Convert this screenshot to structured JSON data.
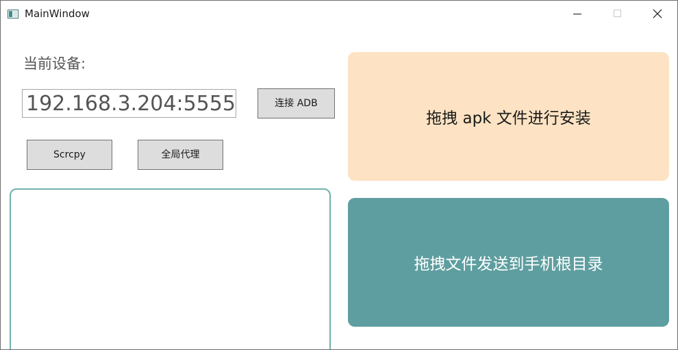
{
  "window": {
    "title": "MainWindow",
    "icon": "app-window-icon",
    "controls": {
      "minimize_icon": "minimize-icon",
      "maximize_icon": "maximize-icon",
      "close_icon": "close-icon"
    }
  },
  "device": {
    "label": "当前设备:",
    "address_value": "192.168.3.204:5555"
  },
  "buttons": {
    "connect_adb": "连接 ADB",
    "scrcpy": "Scrcpy",
    "global_proxy": "全局代理"
  },
  "drop_zones": {
    "apk_install": {
      "label": "拖拽 apk 文件进行安装",
      "color": "#fde3c3"
    },
    "send_file": {
      "label": "拖拽文件发送到手机根目录",
      "color": "#5f9ea0"
    }
  },
  "log_panel": {
    "border_color": "#6fb0ab"
  }
}
